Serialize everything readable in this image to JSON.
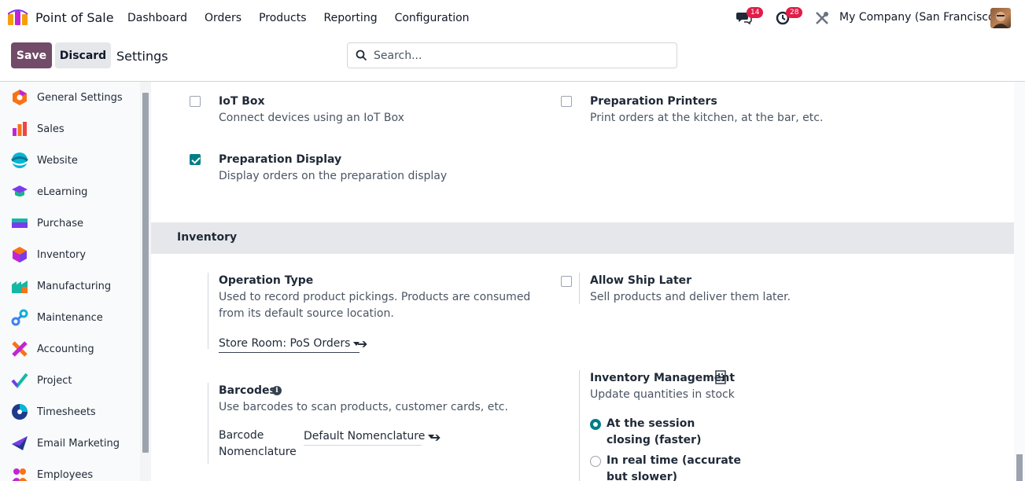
{
  "navbar": {
    "app_name": "Point of Sale",
    "menu": [
      "Dashboard",
      "Orders",
      "Products",
      "Reporting",
      "Configuration"
    ],
    "messages_count": "14",
    "activities_count": "28",
    "company": "My Company (San Francisco)"
  },
  "controlbar": {
    "save_label": "Save",
    "discard_label": "Discard",
    "title": "Settings",
    "search_placeholder": "Search..."
  },
  "sidebar": {
    "items": [
      {
        "label": "General Settings",
        "icon": "general-settings-icon"
      },
      {
        "label": "Sales",
        "icon": "sales-icon"
      },
      {
        "label": "Website",
        "icon": "website-icon"
      },
      {
        "label": "eLearning",
        "icon": "elearning-icon"
      },
      {
        "label": "Purchase",
        "icon": "purchase-icon"
      },
      {
        "label": "Inventory",
        "icon": "inventory-icon"
      },
      {
        "label": "Manufacturing",
        "icon": "manufacturing-icon"
      },
      {
        "label": "Maintenance",
        "icon": "maintenance-icon"
      },
      {
        "label": "Accounting",
        "icon": "accounting-icon"
      },
      {
        "label": "Project",
        "icon": "project-icon"
      },
      {
        "label": "Timesheets",
        "icon": "timesheets-icon"
      },
      {
        "label": "Email Marketing",
        "icon": "email-marketing-icon"
      },
      {
        "label": "Employees",
        "icon": "employees-icon"
      }
    ]
  },
  "settings": {
    "iot_box": {
      "title": "IoT Box",
      "desc": "Connect devices using an IoT Box",
      "checked": false
    },
    "prep_printers": {
      "title": "Preparation Printers",
      "desc": "Print orders at the kitchen, at the bar, etc.",
      "checked": false
    },
    "prep_display": {
      "title": "Preparation Display",
      "desc": "Display orders on the preparation display",
      "checked": true
    }
  },
  "inventory": {
    "section_title": "Inventory",
    "operation_type": {
      "title": "Operation Type",
      "desc": "Used to record product pickings. Products are consumed from its default source location.",
      "value": "Store Room: PoS Orders"
    },
    "allow_ship_later": {
      "title": "Allow Ship Later",
      "desc": "Sell products and deliver them later.",
      "checked": false
    },
    "barcodes": {
      "title": "Barcodes",
      "desc": "Use barcodes to scan products, customer cards, etc.",
      "field_label": "Barcode Nomenclature",
      "value": "Default Nomenclature"
    },
    "inventory_management": {
      "title": "Inventory Management",
      "desc": "Update quantities in stock",
      "option1": "At the session closing (faster)",
      "option2": "In real time (accurate but slower)"
    }
  },
  "colors": {
    "primary": "#714b67",
    "accent": "#017e84",
    "badge": "#e11d48"
  }
}
